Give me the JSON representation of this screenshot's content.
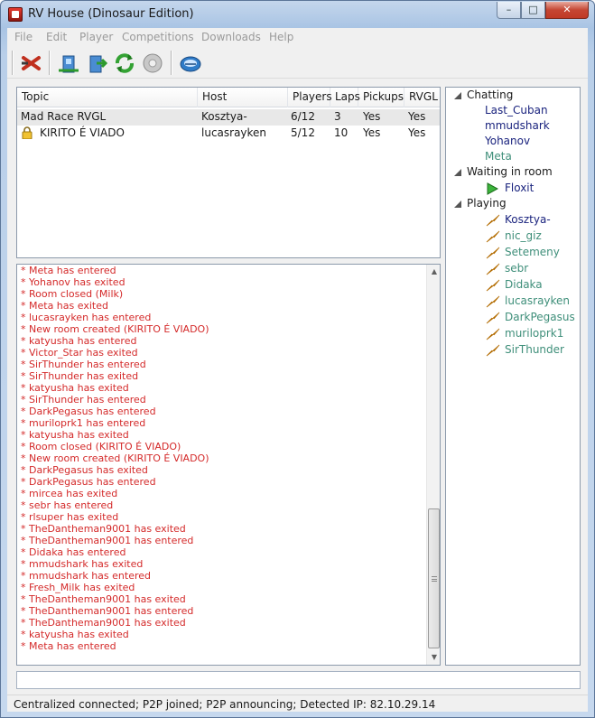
{
  "window": {
    "title": "RV House (Dinosaur Edition)",
    "min": "–",
    "max": "□",
    "close": "✕"
  },
  "menu": [
    "File",
    "Edit",
    "Player",
    "Competitions",
    "Downloads",
    "Help"
  ],
  "rooms": {
    "columns": [
      "Topic",
      "Host",
      "Players",
      "Laps",
      "Pickups",
      "RVGL"
    ],
    "rows": [
      {
        "topic": "Mad Race RVGL",
        "host": "Kosztya-",
        "players": "6/12",
        "laps": "3",
        "pickups": "Yes",
        "rvgl": "Yes",
        "locked": false
      },
      {
        "topic": "KIRITO É VIADO",
        "host": "lucasrayken",
        "players": "5/12",
        "laps": "10",
        "pickups": "Yes",
        "rvgl": "Yes",
        "locked": true
      }
    ]
  },
  "log": [
    "* Meta has entered",
    "* Yohanov has exited",
    "* Room closed (Milk)",
    "* Meta has exited",
    "* lucasrayken has entered",
    "* New room created (KIRITO É VIADO)",
    "* katyusha has entered",
    "* Victor_Star has exited",
    "* SirThunder has entered",
    "* SirThunder has exited",
    "* katyusha has exited",
    "* SirThunder has entered",
    "* DarkPegasus has entered",
    "* muriloprk1 has entered",
    "* katyusha has exited",
    "* Room closed (KIRITO É VIADO)",
    "* New room created (KIRITO É VIADO)",
    "* DarkPegasus has exited",
    "* DarkPegasus has entered",
    "* mircea has exited",
    "* sebr has entered",
    "* rlsuper has exited",
    "* TheDantheman9001 has exited",
    "* TheDantheman9001 has entered",
    "* Didaka has entered",
    "* mmudshark has exited",
    "* mmudshark has entered",
    "* Fresh_Milk has exited",
    "* TheDantheman9001 has exited",
    "* TheDantheman9001 has entered",
    "* TheDantheman9001 has exited",
    "* katyusha has exited",
    "* Meta has entered"
  ],
  "players": {
    "chatting_label": "Chatting",
    "chatting": [
      {
        "name": "Last_Cuban",
        "color": "#1a237e"
      },
      {
        "name": "mmudshark",
        "color": "#1a237e"
      },
      {
        "name": "Yohanov",
        "color": "#1a237e"
      },
      {
        "name": "Meta",
        "color": "#3f8f7a"
      }
    ],
    "waiting_label": "Waiting in room",
    "waiting": [
      {
        "name": "Floxit",
        "color": "#1a237e"
      }
    ],
    "playing_label": "Playing",
    "playing": [
      {
        "name": "Kosztya-",
        "color": "#1a237e"
      },
      {
        "name": "nic_giz",
        "color": "#3f8f7a"
      },
      {
        "name": "Setemeny",
        "color": "#3f8f7a"
      },
      {
        "name": "sebr",
        "color": "#3f8f7a"
      },
      {
        "name": "Didaka",
        "color": "#3f8f7a"
      },
      {
        "name": "lucasrayken",
        "color": "#3f8f7a"
      },
      {
        "name": "DarkPegasus",
        "color": "#3f8f7a"
      },
      {
        "name": "muriloprk1",
        "color": "#3f8f7a"
      },
      {
        "name": "SirThunder",
        "color": "#3f8f7a"
      }
    ]
  },
  "toolbar_icons": [
    "disconnect-icon",
    "host-room-icon",
    "join-room-icon",
    "refresh-icon",
    "disabled-disc-icon",
    "settings-icon"
  ],
  "chat_input": {
    "value": "",
    "placeholder": ""
  },
  "status": "Centralized connected; P2P joined; P2P announcing; Detected IP: 82.10.29.14"
}
